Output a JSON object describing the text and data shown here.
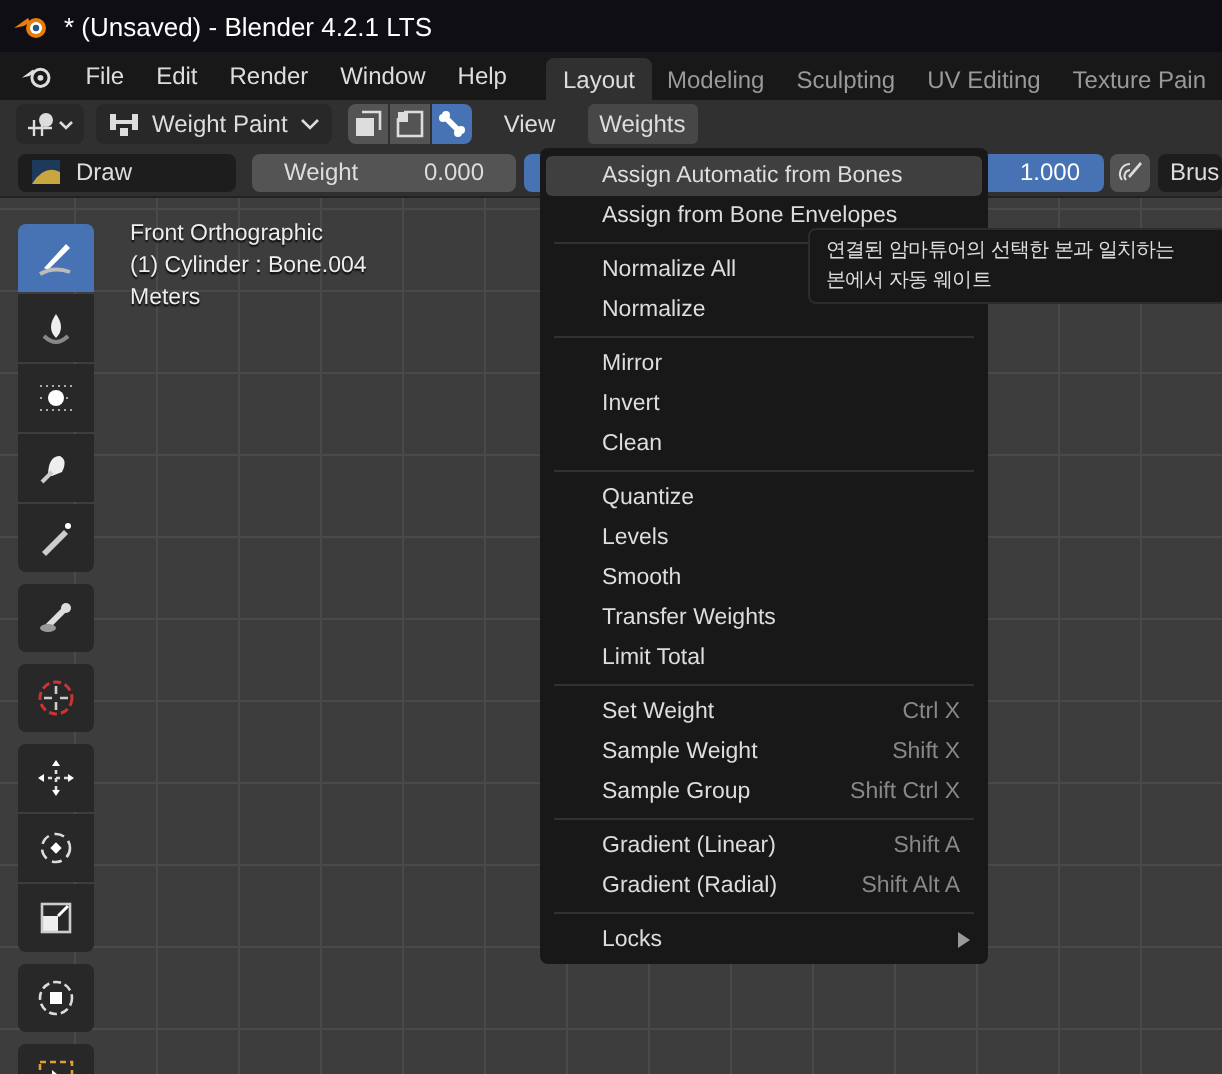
{
  "window": {
    "title": "* (Unsaved) - Blender 4.2.1 LTS"
  },
  "menubar": [
    "File",
    "Edit",
    "Render",
    "Window",
    "Help"
  ],
  "workspace_tabs": [
    {
      "label": "Layout",
      "selected": true
    },
    {
      "label": "Modeling",
      "selected": false
    },
    {
      "label": "Sculpting",
      "selected": false
    },
    {
      "label": "UV Editing",
      "selected": false
    },
    {
      "label": "Texture Pain",
      "selected": false
    }
  ],
  "header": {
    "mode": "Weight Paint",
    "toggles": [
      {
        "kind": "face",
        "selected": false
      },
      {
        "kind": "vertex",
        "selected": false
      },
      {
        "kind": "bone",
        "selected": true
      }
    ],
    "menus": [
      {
        "label": "View",
        "selected": false
      },
      {
        "label": "Weights",
        "selected": true
      }
    ]
  },
  "tool_settings": {
    "brush": "Draw",
    "weight_label": "Weight",
    "weight_value": "0.000",
    "strength_value": "1.000",
    "brush_cut": "Brus"
  },
  "viewport": {
    "overlay": [
      "Front Orthographic",
      "(1) Cylinder : Bone.004",
      "Meters"
    ]
  },
  "toolbar": [
    [
      {
        "kind": "draw",
        "selected": true
      },
      {
        "kind": "blur",
        "selected": false
      },
      {
        "kind": "average",
        "selected": false
      },
      {
        "kind": "smear",
        "selected": false
      },
      {
        "kind": "gradient",
        "selected": false
      }
    ],
    [
      {
        "kind": "sample",
        "selected": false
      }
    ],
    [
      {
        "kind": "cursor",
        "selected": false
      }
    ],
    [
      {
        "kind": "move",
        "selected": false
      },
      {
        "kind": "rotate",
        "selected": false
      },
      {
        "kind": "scale",
        "selected": false
      }
    ],
    [
      {
        "kind": "transform",
        "selected": false
      }
    ],
    [
      {
        "kind": "select",
        "selected": false
      }
    ]
  ],
  "weights_menu": [
    [
      {
        "label": "Assign Automatic from Bones",
        "selected": true
      },
      {
        "label": "Assign from Bone Envelopes",
        "selected": false
      }
    ],
    [
      {
        "label": "Normalize All",
        "selected": false
      },
      {
        "label": "Normalize",
        "selected": false
      }
    ],
    [
      {
        "label": "Mirror",
        "selected": false
      },
      {
        "label": "Invert",
        "selected": false
      },
      {
        "label": "Clean",
        "selected": false
      }
    ],
    [
      {
        "label": "Quantize",
        "selected": false
      },
      {
        "label": "Levels",
        "selected": false
      },
      {
        "label": "Smooth",
        "selected": false
      },
      {
        "label": "Transfer Weights",
        "selected": false
      },
      {
        "label": "Limit Total",
        "selected": false
      }
    ],
    [
      {
        "label": "Set Weight",
        "shortcut": "Ctrl X",
        "selected": false
      },
      {
        "label": "Sample Weight",
        "shortcut": "Shift X",
        "selected": false
      },
      {
        "label": "Sample Group",
        "shortcut": "Shift Ctrl X",
        "selected": false
      }
    ],
    [
      {
        "label": "Gradient (Linear)",
        "shortcut": "Shift A",
        "selected": false
      },
      {
        "label": "Gradient (Radial)",
        "shortcut": "Shift Alt A",
        "selected": false
      }
    ],
    [
      {
        "label": "Locks",
        "submenu": true,
        "selected": false
      }
    ]
  ],
  "tooltip": [
    "연결된 암마튜어의 선택한 본과 일치하는",
    "본에서 자동 웨이트"
  ]
}
